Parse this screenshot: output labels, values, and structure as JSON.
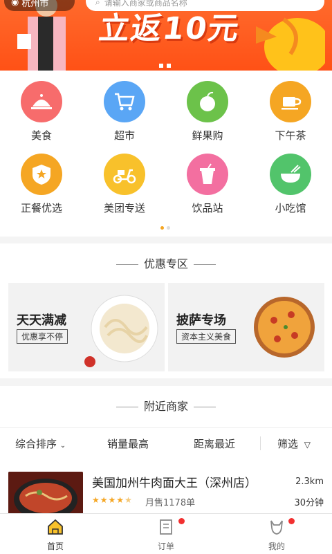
{
  "top": {
    "location": "杭州市",
    "search_placeholder": "请输入商家或商品名称",
    "banner_headline": "立返10元"
  },
  "categories": [
    {
      "label": "美食",
      "icon": "cloche-icon",
      "color": "#f76c6c"
    },
    {
      "label": "超市",
      "icon": "cart-icon",
      "color": "#5aa6f5"
    },
    {
      "label": "鲜果购",
      "icon": "apple-icon",
      "color": "#6cc24a"
    },
    {
      "label": "下午茶",
      "icon": "cup-icon",
      "color": "#f5a623"
    },
    {
      "label": "正餐优选",
      "icon": "star-shield-icon",
      "color": "#f5a623"
    },
    {
      "label": "美团专送",
      "icon": "scooter-icon",
      "color": "#f8c12b"
    },
    {
      "label": "饮品站",
      "icon": "drink-icon",
      "color": "#f36fa0"
    },
    {
      "label": "小吃馆",
      "icon": "bowl-icon",
      "color": "#52c46b"
    }
  ],
  "promo": {
    "title": "优惠专区",
    "cards": [
      {
        "title": "天天满减",
        "tag": "优惠享不停"
      },
      {
        "title": "披萨专场",
        "tag": "资本主义美食"
      }
    ]
  },
  "nearby": {
    "title": "附近商家",
    "filters": [
      "综合排序",
      "销量最高",
      "距离最近",
      "筛选"
    ]
  },
  "shop": {
    "name": "美国加州牛肉面大王（深州店）",
    "distance": "2.3km",
    "sales": "月售1178单",
    "time": "30分钟",
    "rating": 4.5
  },
  "tabs": [
    {
      "label": "首页",
      "icon": "home-icon"
    },
    {
      "label": "订单",
      "icon": "order-icon"
    },
    {
      "label": "我的",
      "icon": "profile-icon"
    }
  ],
  "colors": {
    "accent": "#f5a623",
    "banner": "#ff5a1f",
    "badge": "#f23030"
  }
}
